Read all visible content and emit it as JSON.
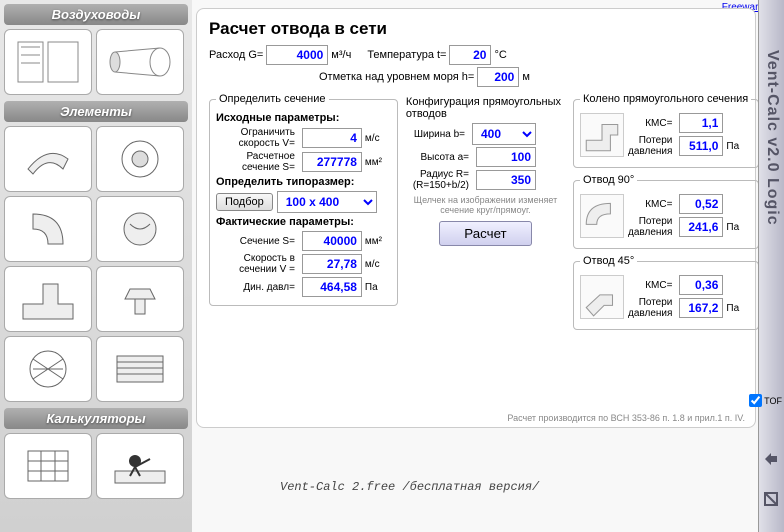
{
  "app": {
    "vertical_title": "Vent-Calc v2.0 Logic",
    "freeware": "Freeware",
    "tor_label": "TOF"
  },
  "sidebar": {
    "s1": "Воздуховоды",
    "s2": "Элементы",
    "s3": "Калькуляторы"
  },
  "main": {
    "title": "Расчет отвода в сети",
    "flow_label": "Расход G=",
    "flow_value": "4000",
    "flow_unit": "м³/ч",
    "temp_label": "Температура t=",
    "temp_value": "20",
    "temp_unit": "°С",
    "alt_label": "Отметка над уровнем моря h=",
    "alt_value": "200",
    "alt_unit": "м",
    "section_legend": "Определить сечение",
    "initial_params": "Исходные параметры:",
    "limit_v_label": "Ограничить скорость V=",
    "limit_v_value": "4",
    "limit_v_unit": "м/с",
    "calc_s_label": "Расчетное сечение S=",
    "calc_s_value": "277778",
    "calc_s_unit": "мм²",
    "size_title": "Определить типоразмер:",
    "pick_btn": "Подбор",
    "size_select": "100 x 400",
    "actual_params": "Фактические параметры:",
    "act_s_label": "Сечение S=",
    "act_s_value": "40000",
    "act_s_unit": "мм²",
    "act_v_label": "Скорость в сечении V =",
    "act_v_value": "27,78",
    "act_v_unit": "м/с",
    "dyn_p_label": "Дин. давл=",
    "dyn_p_value": "464,58",
    "dyn_p_unit": "Па",
    "config_title": "Конфигурация прямоугольных отводов",
    "width_label": "Ширина b=",
    "width_value": "400",
    "height_label": "Высота a=",
    "height_value": "100",
    "radius_label": "Радиус R= (R=150+b/2)",
    "radius_value": "350",
    "hint": "Щелчек на изображении изменяет сечение круг/прямоуг.",
    "calc_btn": "Расчет",
    "fit1_legend": "Колено прямоугольного сечения",
    "fit2_legend": "Отвод 90°",
    "fit3_legend": "Отвод 45°",
    "kmc_label": "КМС=",
    "loss_label": "Потери давления",
    "pa": "Па",
    "fit1_kmc": "1,1",
    "fit1_loss": "511,0",
    "fit2_kmc": "0,52",
    "fit2_loss": "241,6",
    "fit3_kmc": "0,36",
    "fit3_loss": "167,2",
    "footer": "Расчет производится по ВСН 353-86 п. 1.8 и прил.1 п. IV."
  },
  "version": "Vent-Calc 2.free /бесплатная версия/"
}
